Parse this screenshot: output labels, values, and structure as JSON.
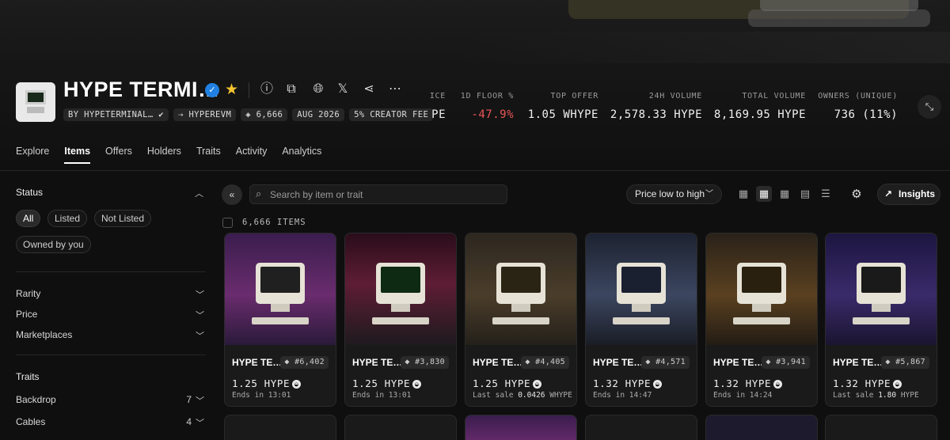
{
  "collection": {
    "title": "HYPE TERMI…",
    "chips": [
      "BY HYPETERMINAL… ✔",
      "⇢ HYPEREVM",
      "◈ 6,666",
      "AUG 2026",
      "5% CREATOR FEE"
    ]
  },
  "stats": [
    {
      "label": "ICE",
      "value": "PE"
    },
    {
      "label": "1D FLOOR %",
      "value": "-47.9%"
    },
    {
      "label": "TOP OFFER",
      "value": "1.05 WHYPE"
    },
    {
      "label": "24H VOLUME",
      "value": "2,578.33 HYPE"
    },
    {
      "label": "TOTAL VOLUME",
      "value": "8,169.95 HYPE"
    },
    {
      "label": "OWNERS (UNIQUE)",
      "value": "736 (11%)"
    }
  ],
  "tabs": [
    "Explore",
    "Items",
    "Offers",
    "Holders",
    "Traits",
    "Activity",
    "Analytics"
  ],
  "sidebar": {
    "status_title": "Status",
    "status_pills": [
      "All",
      "Listed",
      "Not Listed",
      "Owned by you"
    ],
    "filters": [
      "Rarity",
      "Price",
      "Marketplaces"
    ],
    "traits_title": "Traits",
    "traits": [
      {
        "label": "Backdrop",
        "count": "7"
      },
      {
        "label": "Cables",
        "count": "4"
      }
    ]
  },
  "toolbar": {
    "search_placeholder": "Search by item or trait",
    "sort_label": "Price low to high",
    "insights_label": "Insights"
  },
  "items_count": "6,666 ITEMS",
  "cards": [
    {
      "name": "HYPE TE…",
      "number": "◆ #6,402",
      "price": "1.25 HYPE",
      "sub_prefix": "Ends in 13:01",
      "sub_value": "",
      "sub_suffix": ""
    },
    {
      "name": "HYPE TE…",
      "number": "◆ #3,830",
      "price": "1.25 HYPE",
      "sub_prefix": "Ends in 13:01",
      "sub_value": "",
      "sub_suffix": ""
    },
    {
      "name": "HYPE TE…",
      "number": "◆ #4,405",
      "price": "1.25 HYPE",
      "sub_prefix": "Last sale ",
      "sub_value": "0.0426",
      "sub_suffix": " WHYPE"
    },
    {
      "name": "HYPE TE…",
      "number": "◆ #4,571",
      "price": "1.32 HYPE",
      "sub_prefix": "Ends in 14:47",
      "sub_value": "",
      "sub_suffix": ""
    },
    {
      "name": "HYPE TE…",
      "number": "◆ #3,941",
      "price": "1.32 HYPE",
      "sub_prefix": "Ends in 14:24",
      "sub_value": "",
      "sub_suffix": ""
    },
    {
      "name": "HYPE TE…",
      "number": "◆ #5,867",
      "price": "1.32 HYPE",
      "sub_prefix": "Last sale ",
      "sub_value": "1.80",
      "sub_suffix": " HYPE"
    }
  ],
  "card_backgrounds": [
    "linear-gradient(180deg,#3a1d4e 0%,#6a2c6e 55%,#2a1a3a 100%)",
    "linear-gradient(180deg,#2a0d1a 0%,#5e1d34 45%,#1e1a1e 100%)",
    "linear-gradient(180deg,#2d2720 0%,#4a3d2a 55%,#24201a 100%)",
    "linear-gradient(180deg,#1c2230 0%,#3c4660 55%,#1a1d26 100%)",
    "linear-gradient(180deg,#2a2219 0%,#5a4020 55%,#231c14 100%)",
    "linear-gradient(180deg,#1c1640 0%,#3a2a6a 55%,#1a1530 100%)"
  ],
  "screen_colors": [
    "#202020",
    "#0f2a12",
    "#2a2414",
    "#1b2030",
    "#2a2010",
    "#1a1a1a"
  ]
}
